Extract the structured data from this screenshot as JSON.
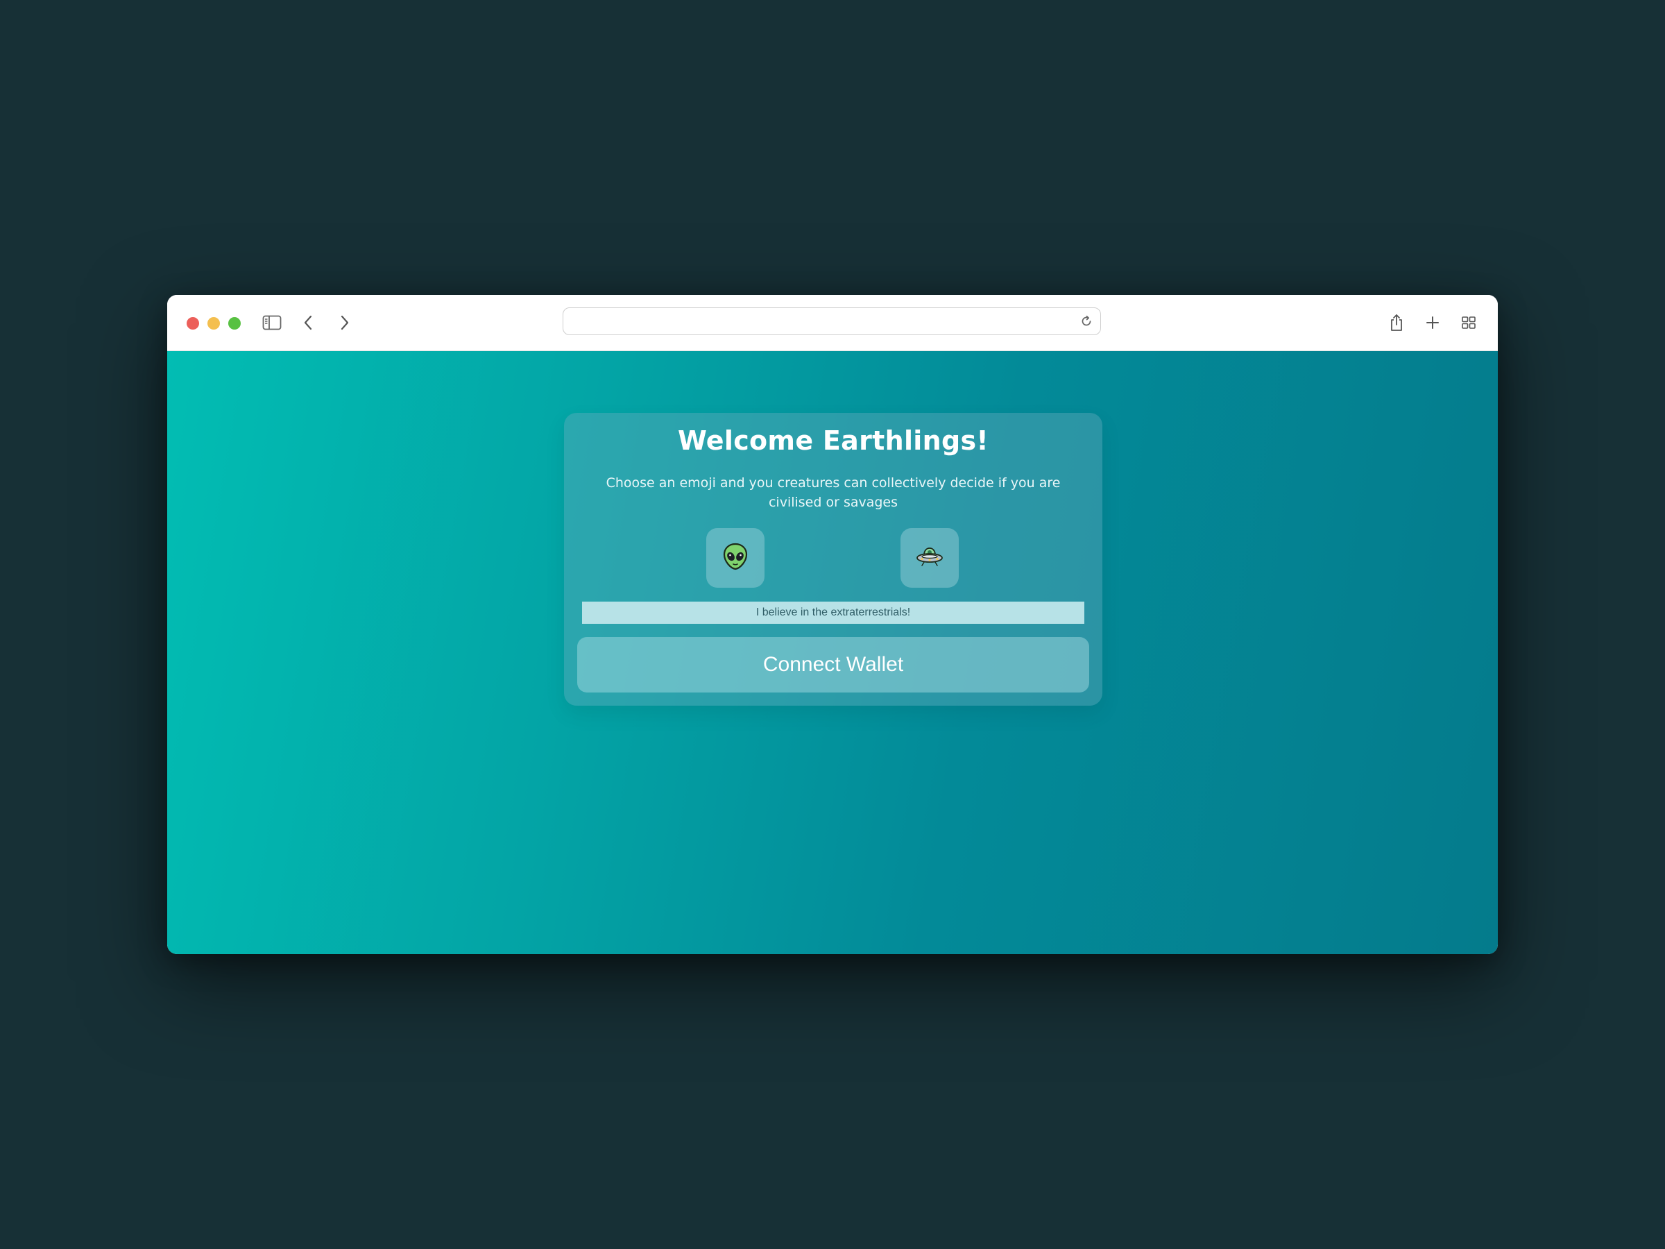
{
  "browser": {
    "traffic_lights": {
      "close": "#ec5f5a",
      "minimize": "#f4bf4f",
      "maximize": "#58c142"
    },
    "icons": [
      "sidebar-icon",
      "back-icon",
      "forward-icon",
      "reload-icon",
      "share-icon",
      "new-tab-icon",
      "tab-overview-icon"
    ],
    "url_value": ""
  },
  "page": {
    "title": "Welcome Earthlings!",
    "subtitle": "Choose an emoji and you creatures can collectively decide if you are civilised or savages",
    "emoji_options": [
      {
        "icon": "alien-icon",
        "glyph": "👽"
      },
      {
        "icon": "ufo-icon",
        "glyph": "🛸"
      }
    ],
    "banner_text": "I believe in the extraterrestrials!",
    "connect_label": "Connect Wallet"
  },
  "colors": {
    "desktop": "#173036",
    "gradient_start": "#02bdb3",
    "gradient_end": "#047b8c"
  }
}
